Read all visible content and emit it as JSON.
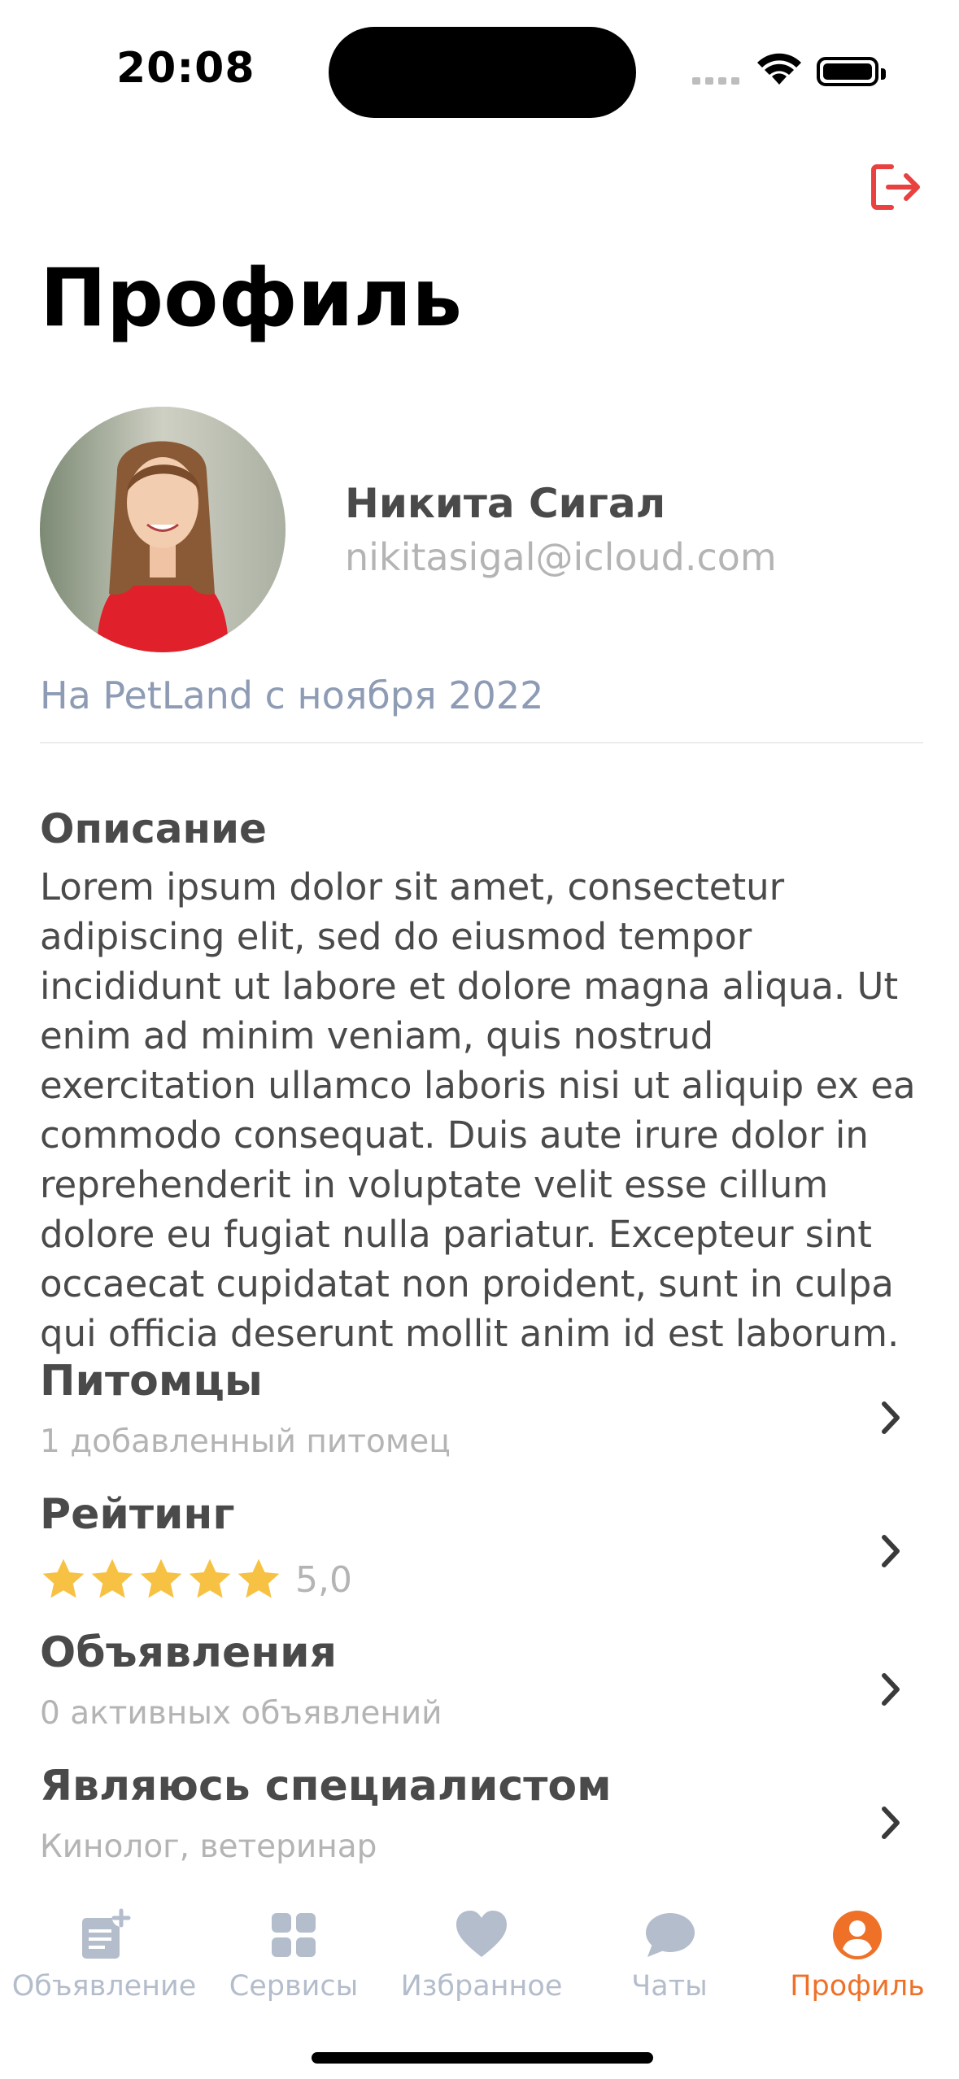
{
  "status_bar": {
    "time": "20:08"
  },
  "header": {
    "title": "Профиль",
    "logout_icon": "logout-icon"
  },
  "profile": {
    "name": "Никита Сигал",
    "email": "nikitasigal@icloud.com",
    "member_since": "На PetLand с ноября 2022"
  },
  "description": {
    "heading": "Описание",
    "text": "Lorem ipsum dolor sit amet, consectetur adipiscing elit, sed do eiusmod tempor incididunt ut labore et dolore magna aliqua. Ut enim ad minim veniam, quis nostrud exercitation ullamco laboris nisi ut aliquip ex ea commodo consequat. Duis aute irure dolor in reprehenderit in voluptate velit esse cillum dolore eu fugiat nulla pariatur. Excepteur sint occaecat cupidatat non proident, sunt in culpa qui officia deserunt mollit anim id est laborum."
  },
  "rows": {
    "pets": {
      "title": "Питомцы",
      "subtitle": "1 добавленный питомец"
    },
    "rating": {
      "title": "Рейтинг",
      "value": "5,0",
      "stars": 5
    },
    "ads": {
      "title": "Объявления",
      "subtitle": "0 активных объявлений"
    },
    "specialist": {
      "title": "Являюсь специалистом",
      "subtitle": "Кинолог, ветеринар"
    }
  },
  "tabbar": {
    "items": [
      {
        "label": "Объявление",
        "icon": "new-ad-icon"
      },
      {
        "label": "Сервисы",
        "icon": "grid-icon"
      },
      {
        "label": "Избранное",
        "icon": "heart-icon"
      },
      {
        "label": "Чаты",
        "icon": "chat-bubble-icon"
      },
      {
        "label": "Профиль",
        "icon": "profile-icon"
      }
    ],
    "active_index": 4
  },
  "colors": {
    "accent": "#ef7128",
    "logout": "#e8413f",
    "star": "#f7c244",
    "inactive": "#b4bdcc"
  }
}
